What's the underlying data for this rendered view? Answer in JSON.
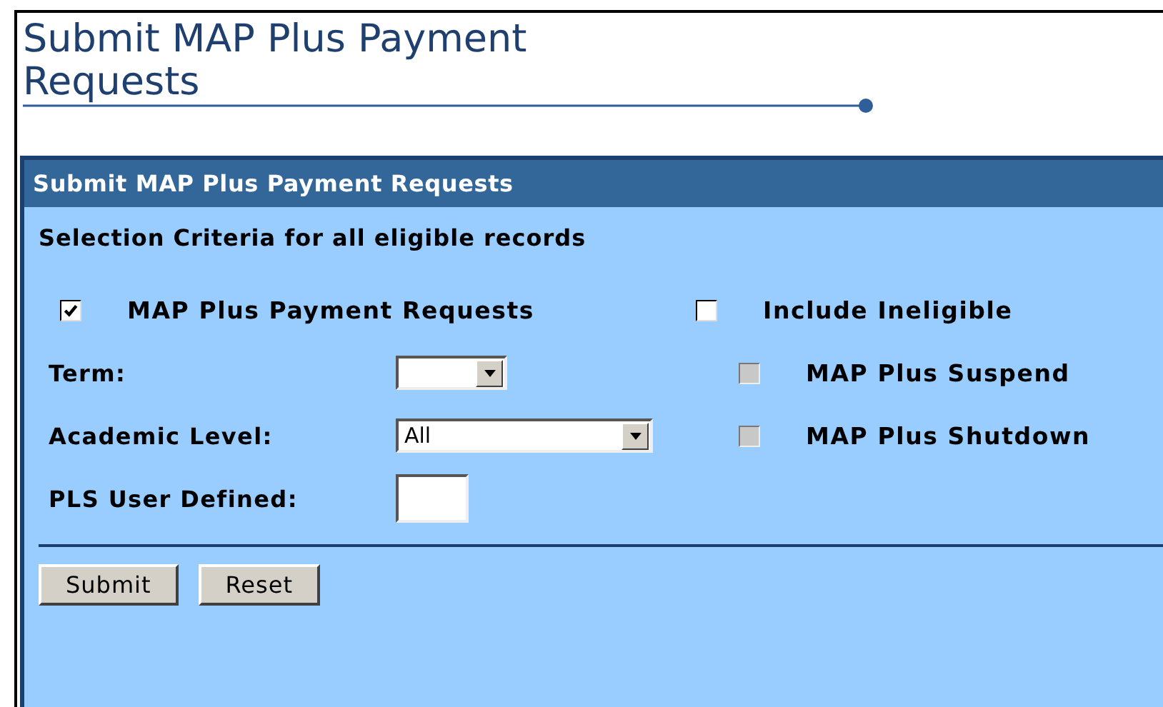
{
  "page_title": "Submit MAP Plus Payment Requests",
  "panel": {
    "title": "Submit MAP Plus Payment Requests",
    "section_label": "Selection Criteria for all eligible records",
    "top_checkboxes": [
      {
        "label": "MAP Plus Payment Requests",
        "checked": true,
        "disabled": false
      },
      {
        "label": "Include Ineligible",
        "checked": false,
        "disabled": false
      }
    ],
    "fields": [
      {
        "kind": "select",
        "label": "Term:"
      },
      {
        "kind": "select",
        "label": "Academic Level:",
        "value": "All"
      },
      {
        "kind": "text",
        "label": "PLS User Defined:"
      }
    ],
    "side_checkboxes": [
      {
        "label": "MAP Plus Suspend",
        "checked": false,
        "disabled": true
      },
      {
        "label": "MAP Plus Shutdown",
        "checked": false,
        "disabled": true
      }
    ],
    "buttons": [
      "Submit",
      "Reset"
    ]
  }
}
